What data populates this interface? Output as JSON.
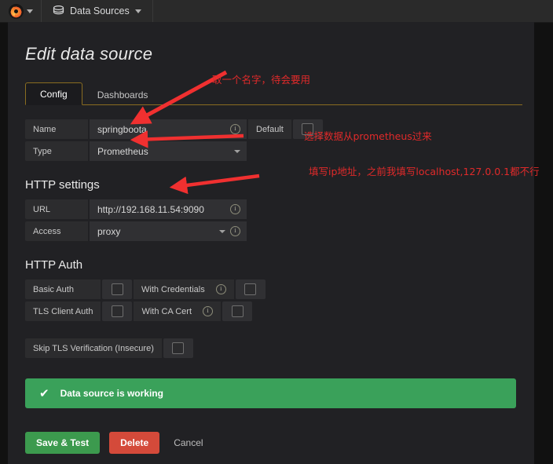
{
  "navbar": {
    "logo_icon": "grafana-logo-icon",
    "logo_caret_icon": "caret-down-icon",
    "item_icon": "database-icon",
    "item_label": "Data Sources",
    "item_caret_icon": "caret-down-icon"
  },
  "page": {
    "title": "Edit data source"
  },
  "tabs": [
    {
      "label": "Config",
      "active": true
    },
    {
      "label": "Dashboards",
      "active": false
    }
  ],
  "basic_settings": {
    "name": {
      "label": "Name",
      "value": "springboota",
      "placeholder": "Name",
      "info_icon": "info-icon"
    },
    "default": {
      "label": "Default",
      "checked": false
    },
    "type": {
      "label": "Type",
      "value": "Prometheus",
      "caret_icon": "caret-down-icon"
    }
  },
  "http_settings": {
    "title": "HTTP settings",
    "url": {
      "label": "URL",
      "value": "http://192.168.11.54:9090",
      "placeholder": "http://localhost:9090",
      "info_icon": "info-icon"
    },
    "access": {
      "label": "Access",
      "value": "proxy",
      "caret_icon": "caret-down-icon",
      "info_icon": "info-icon"
    }
  },
  "http_auth": {
    "title": "HTTP Auth",
    "rows": [
      {
        "left_label": "Basic Auth",
        "left_checked": false,
        "right_label": "With Credentials",
        "right_info_icon": "info-icon",
        "right_checked": false
      },
      {
        "left_label": "TLS Client Auth",
        "left_checked": false,
        "right_label": "With CA Cert",
        "right_info_icon": "info-icon",
        "right_checked": false
      }
    ],
    "skip_tls": {
      "label": "Skip TLS Verification (Insecure)",
      "checked": false
    }
  },
  "alert": {
    "icon": "check-icon",
    "message": "Data source is working",
    "color": "#3aa15a"
  },
  "buttons": {
    "save": "Save & Test",
    "delete": "Delete",
    "cancel": "Cancel",
    "save_color": "#3c9a4e",
    "delete_color": "#d44a3a"
  },
  "annotations": {
    "accent_color": "#e02a2a",
    "items": [
      {
        "text": "取一个名字，待会要用"
      },
      {
        "text": "选择数据从prometheus过来"
      },
      {
        "text": "填写ip地址，之前我填写localhost,127.0.0.1都不行"
      }
    ]
  }
}
